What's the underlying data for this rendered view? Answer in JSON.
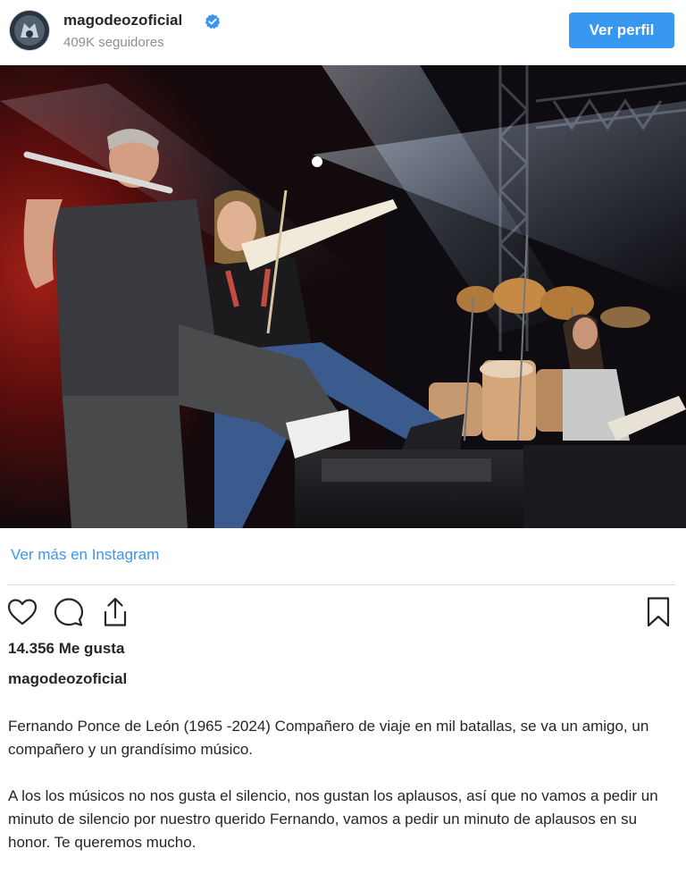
{
  "header": {
    "username": "magodeozoficial",
    "followers": "409K seguidores",
    "profile_button": "Ver perfil",
    "verified_icon": "verified-badge-icon"
  },
  "post": {
    "image": "concert-photo-flute-violin-drums-guitar",
    "more_link": "Ver más en Instagram",
    "likes": "14.356 Me gusta",
    "caption_user": "magodeozoficial",
    "caption_p1": "Fernando Ponce de León (1965 -2024) Compañero de viaje en mil batallas, se va un amigo, un compañero y un grandísimo músico.",
    "caption_p2": "A los los músicos no nos gusta el silencio, nos gustan los aplausos, así que no vamos a pedir un minuto de silencio por nuestro querido Fernando, vamos a pedir un minuto de aplausos en su honor. Te queremos mucho."
  },
  "actions": {
    "like_icon": "heart-icon",
    "comment_icon": "comment-icon",
    "share_icon": "share-icon",
    "save_icon": "bookmark-icon"
  },
  "colors": {
    "accent": "#3897f0",
    "text": "#262626",
    "muted": "#8e8e8e",
    "divider": "#dbdbdb"
  }
}
